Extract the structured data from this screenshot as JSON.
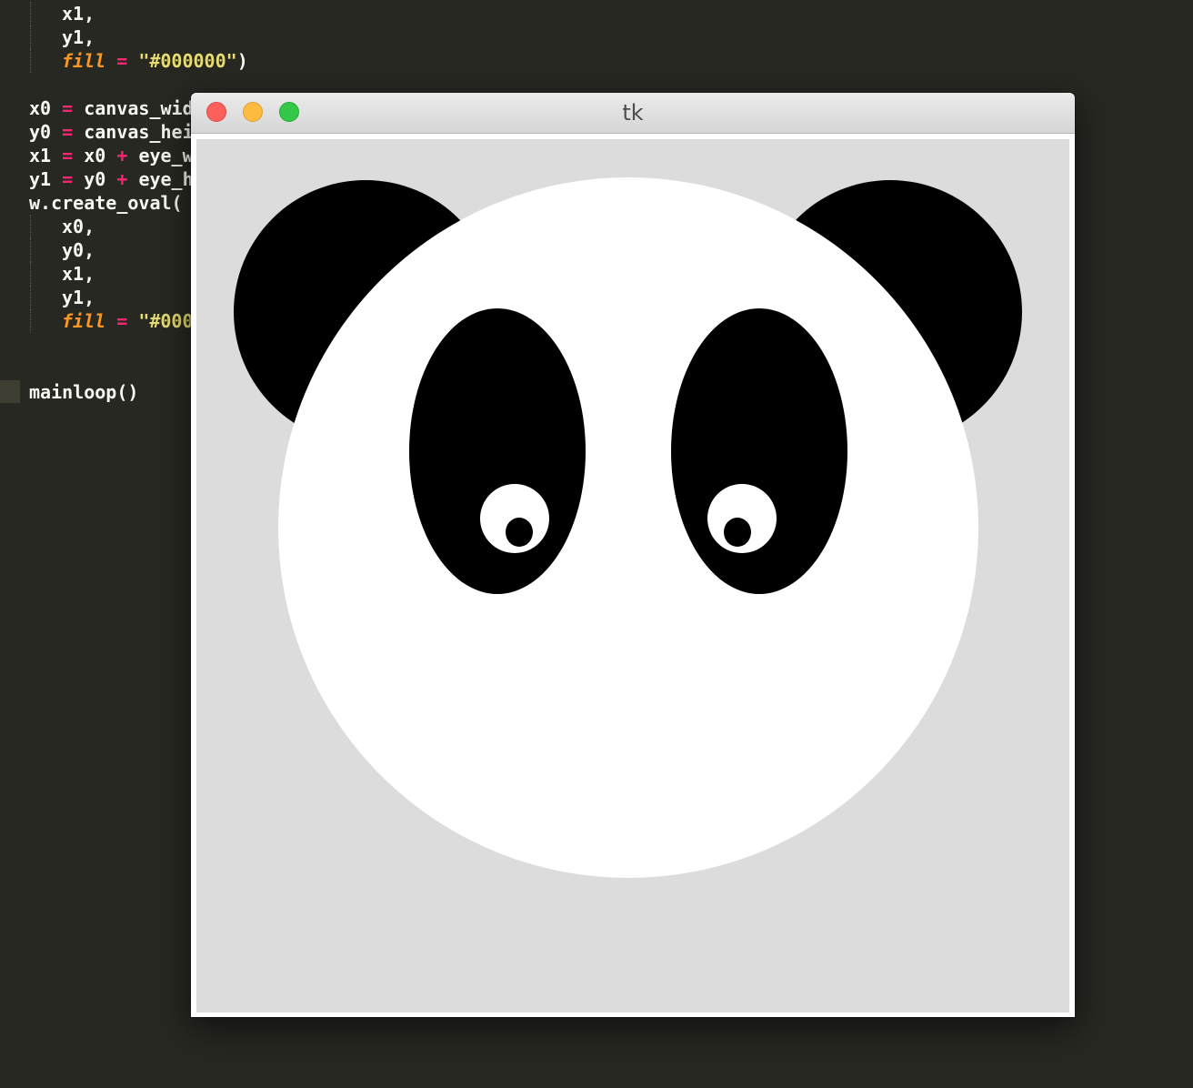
{
  "editor": {
    "colors": {
      "background": "#272822",
      "text": "#f8f8f2",
      "operator": "#f92672",
      "string": "#e6db74",
      "keyword": "#fd971f"
    },
    "lines": [
      {
        "indent": true,
        "tokens": [
          {
            "t": "x1,",
            "c": "txt"
          }
        ]
      },
      {
        "indent": true,
        "tokens": [
          {
            "t": "y1,",
            "c": "txt"
          }
        ]
      },
      {
        "indent": true,
        "tokens": [
          {
            "t": "fill",
            "c": "kw"
          },
          {
            "t": " ",
            "c": "txt"
          },
          {
            "t": "=",
            "c": "op"
          },
          {
            "t": " ",
            "c": "txt"
          },
          {
            "t": "\"#000000\"",
            "c": "str"
          },
          {
            "t": ")",
            "c": "txt"
          }
        ]
      },
      {
        "indent": false,
        "tokens": []
      },
      {
        "indent": false,
        "tokens": [
          {
            "t": "x0",
            "c": "txt"
          },
          {
            "t": " = ",
            "c": "op"
          },
          {
            "t": "canvas_wid",
            "c": "txt"
          }
        ]
      },
      {
        "indent": false,
        "tokens": [
          {
            "t": "y0",
            "c": "txt"
          },
          {
            "t": " = ",
            "c": "op"
          },
          {
            "t": "canvas_hei",
            "c": "txt"
          }
        ]
      },
      {
        "indent": false,
        "tokens": [
          {
            "t": "x1",
            "c": "txt"
          },
          {
            "t": " = ",
            "c": "op"
          },
          {
            "t": "x0",
            "c": "txt"
          },
          {
            "t": " + ",
            "c": "op"
          },
          {
            "t": "eye_w",
            "c": "txt"
          }
        ]
      },
      {
        "indent": false,
        "tokens": [
          {
            "t": "y1",
            "c": "txt"
          },
          {
            "t": " = ",
            "c": "op"
          },
          {
            "t": "y0",
            "c": "txt"
          },
          {
            "t": " + ",
            "c": "op"
          },
          {
            "t": "eye_h",
            "c": "txt"
          }
        ]
      },
      {
        "indent": false,
        "tokens": [
          {
            "t": "w.create_oval(",
            "c": "txt"
          }
        ]
      },
      {
        "indent": true,
        "tokens": [
          {
            "t": "x0,",
            "c": "txt"
          }
        ]
      },
      {
        "indent": true,
        "tokens": [
          {
            "t": "y0,",
            "c": "txt"
          }
        ]
      },
      {
        "indent": true,
        "tokens": [
          {
            "t": "x1,",
            "c": "txt"
          }
        ]
      },
      {
        "indent": true,
        "tokens": [
          {
            "t": "y1,",
            "c": "txt"
          }
        ]
      },
      {
        "indent": true,
        "tokens": [
          {
            "t": "fill",
            "c": "kw"
          },
          {
            "t": " ",
            "c": "txt"
          },
          {
            "t": "=",
            "c": "op"
          },
          {
            "t": " ",
            "c": "txt"
          },
          {
            "t": "\"#000",
            "c": "str"
          }
        ]
      },
      {
        "indent": false,
        "tokens": []
      },
      {
        "indent": false,
        "tokens": []
      },
      {
        "indent": false,
        "tokens": [
          {
            "t": "mainloop()",
            "c": "txt"
          }
        ]
      }
    ]
  },
  "window": {
    "title": "tk",
    "buttons": {
      "close": "close-window",
      "minimize": "minimize-window",
      "maximize": "maximize-window"
    },
    "colors": {
      "close": "#fc605b",
      "minimize": "#fdbc40",
      "maximize": "#34c84a"
    }
  },
  "canvas": {
    "background": "#dcdcdc",
    "shapes": [
      {
        "name": "left-ear",
        "fill": "#000000"
      },
      {
        "name": "right-ear",
        "fill": "#000000"
      },
      {
        "name": "panda-face",
        "fill": "#ffffff"
      },
      {
        "name": "left-eye-patch",
        "fill": "#000000"
      },
      {
        "name": "right-eye-patch",
        "fill": "#000000"
      },
      {
        "name": "left-eye-white",
        "fill": "#ffffff"
      },
      {
        "name": "right-eye-white",
        "fill": "#ffffff"
      },
      {
        "name": "left-pupil",
        "fill": "#000000"
      },
      {
        "name": "right-pupil",
        "fill": "#000000"
      }
    ]
  }
}
